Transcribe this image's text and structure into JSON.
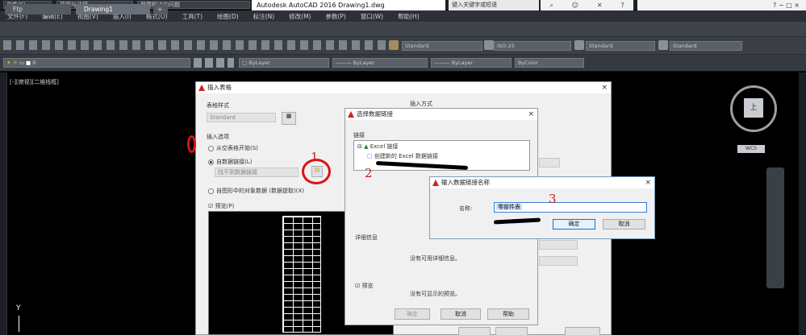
{
  "titlebar": {
    "app_menu": "文件(F)",
    "quick_workspace": "草图与注释",
    "search_prompt": "我要解决的问题",
    "title": "Autodesk AutoCAD 2016   Drawing1.dwg",
    "search_box": "键入关键字或短语",
    "controls": "? − □ ×"
  },
  "menubar": {
    "items": [
      "文件(F)",
      "编辑(E)",
      "视图(V)",
      "插入(I)",
      "格式(O)",
      "工具(T)",
      "绘图(D)",
      "标注(N)",
      "修改(M)",
      "参数(P)",
      "窗口(W)",
      "帮助(H)"
    ]
  },
  "filetabs": {
    "start": "Ftp",
    "drawing": "Drawing1",
    "new": "+"
  },
  "toolbar": {
    "styles": [
      "Standard",
      "ISO-25",
      "Standard",
      "Standard"
    ],
    "layer": "0",
    "props": [
      "ByLayer",
      "ByLayer",
      "ByLayer",
      "ByColor"
    ]
  },
  "viewport": {
    "label": "[-][俯视][二维线框]",
    "ucs_y": "Y",
    "viewcube_face": "上",
    "wcs": "WCS"
  },
  "insert_table": {
    "title": "插入表格",
    "table_style_label": "表格样式",
    "table_style_value": "Standard",
    "insert_options_label": "插入选项",
    "option_empty": "从空表格开始(S)",
    "option_datalink": "自数据链接(L)",
    "datalink_value": "找不到数据链接",
    "option_object_data": "自图形中的对象数据 (数据提取)(X)",
    "preview_label": "预览(P)",
    "insert_method": "插入方式"
  },
  "select_datalink": {
    "title": "选择数据链接",
    "links_label": "链接",
    "tree_root": "Excel 链接",
    "tree_child": "创建新的 Excel 数据链接",
    "details_label": "详细信息",
    "details_text": "没有可用详细信息。",
    "preview_label": "预览",
    "preview_text": "没有可显示的预览。",
    "ok": "确定",
    "cancel": "取消",
    "help": "帮助"
  },
  "datalink_name": {
    "title": "输入数据链接名称",
    "name_label": "名称:",
    "name_value": "零部件表",
    "ok": "确定",
    "cancel": "取消"
  },
  "annotations": {
    "step1": "1",
    "step2": "2",
    "step3": "3"
  },
  "colors": {
    "annotation_red": "#e01010",
    "autocad_red": "#d42020",
    "focus_blue": "#0078d7"
  }
}
